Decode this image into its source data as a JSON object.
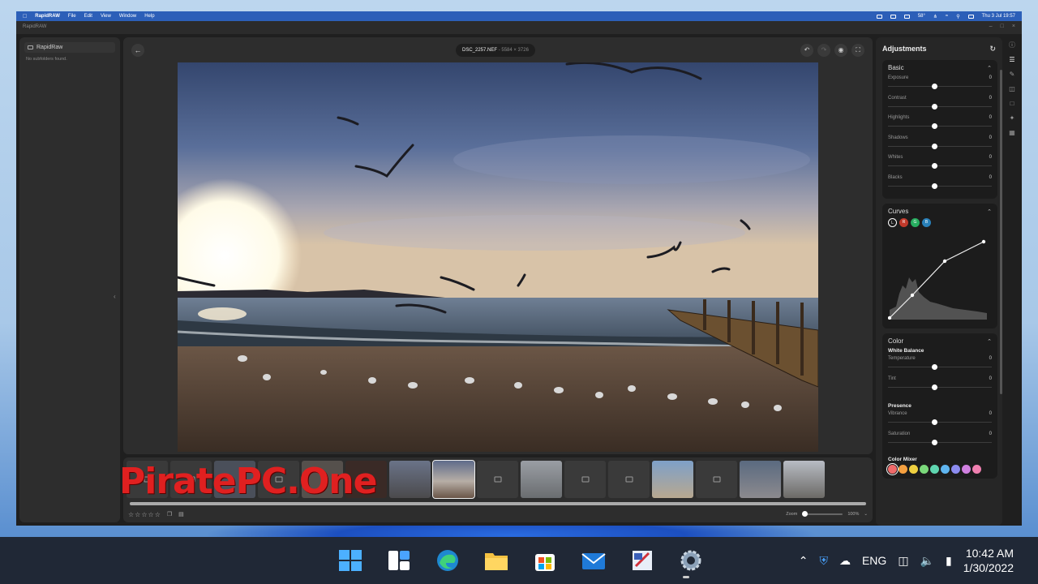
{
  "menubar": {
    "app_name": "RapidRAW",
    "items": [
      "File",
      "Edit",
      "View",
      "Window",
      "Help"
    ],
    "clock": "Thu 3 Jul 19:57",
    "temp": "58°"
  },
  "window": {
    "title": "RapidRAW"
  },
  "left_panel": {
    "folder": "RapidRaw",
    "empty_text": "No subfolders found."
  },
  "viewer": {
    "filename": "DSC_2257.NEF",
    "dimensions": "5584 × 3726"
  },
  "filmstrip": {
    "zoom_label": "Zoom",
    "zoom_value": "100%",
    "zoom_fraction": 0.0,
    "rating": 0
  },
  "watermark": "PiratePC.One",
  "adjustments": {
    "title": "Adjustments",
    "basic": {
      "title": "Basic",
      "sliders": [
        {
          "label": "Exposure",
          "value": "0"
        },
        {
          "label": "Contrast",
          "value": "0"
        },
        {
          "label": "Highlights",
          "value": "0"
        },
        {
          "label": "Shadows",
          "value": "0"
        },
        {
          "label": "Whites",
          "value": "0"
        },
        {
          "label": "Blacks",
          "value": "0"
        }
      ]
    },
    "curves": {
      "title": "Curves",
      "channels": [
        "L",
        "R",
        "G",
        "B"
      ],
      "channel_colors": [
        "#1c1c1c",
        "#c0392b",
        "#27ae60",
        "#2980b9"
      ]
    },
    "color": {
      "title": "Color",
      "white_balance": {
        "title": "White Balance",
        "sliders": [
          {
            "label": "Temperature",
            "value": "0"
          },
          {
            "label": "Tint",
            "value": "0"
          }
        ]
      },
      "presence": {
        "title": "Presence",
        "sliders": [
          {
            "label": "Vibrance",
            "value": "0"
          },
          {
            "label": "Saturation",
            "value": "0"
          }
        ]
      },
      "mixer": {
        "title": "Color Mixer",
        "swatches": [
          "#f06a6a",
          "#f5a040",
          "#f0d040",
          "#7bd97b",
          "#5fd6b0",
          "#5fb5f0",
          "#8c8cf0",
          "#d080e0",
          "#f080b0"
        ]
      }
    }
  },
  "taskbar": {
    "lang": "ENG",
    "time": "10:42 AM",
    "date": "1/30/2022"
  }
}
